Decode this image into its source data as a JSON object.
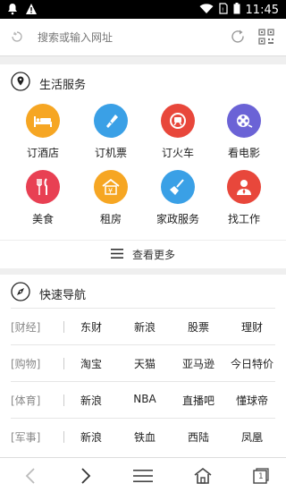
{
  "status": {
    "time": "11:45"
  },
  "urlbar": {
    "placeholder": "搜索或输入网址"
  },
  "life": {
    "title": "生活服务",
    "items": [
      {
        "label": "订酒店",
        "color": "#f6a623",
        "icon": "bed-icon"
      },
      {
        "label": "订机票",
        "color": "#3aa0e6",
        "icon": "ticket-icon"
      },
      {
        "label": "订火车",
        "color": "#e8473b",
        "icon": "train-icon"
      },
      {
        "label": "看电影",
        "color": "#6b63d6",
        "icon": "film-reel-icon"
      },
      {
        "label": "美食",
        "color": "#e84053",
        "icon": "cutlery-icon"
      },
      {
        "label": "租房",
        "color": "#f6a623",
        "icon": "house-yen-icon"
      },
      {
        "label": "家政服务",
        "color": "#3aa0e6",
        "icon": "broom-icon"
      },
      {
        "label": "找工作",
        "color": "#e8473b",
        "icon": "person-tie-icon"
      }
    ],
    "more_label": "查看更多"
  },
  "nav": {
    "title": "快速导航",
    "rows": [
      {
        "category": "[财经]",
        "links": [
          "东财",
          "新浪",
          "股票",
          "理财"
        ]
      },
      {
        "category": "[购物]",
        "links": [
          "淘宝",
          "天猫",
          "亚马逊",
          "今日特价"
        ]
      },
      {
        "category": "[体育]",
        "links": [
          "新浪",
          "NBA",
          "直播吧",
          "懂球帝"
        ]
      },
      {
        "category": "[军事]",
        "links": [
          "新浪",
          "铁血",
          "西陆",
          "凤凰"
        ]
      }
    ]
  },
  "bottom": {
    "tab_count": "1"
  }
}
